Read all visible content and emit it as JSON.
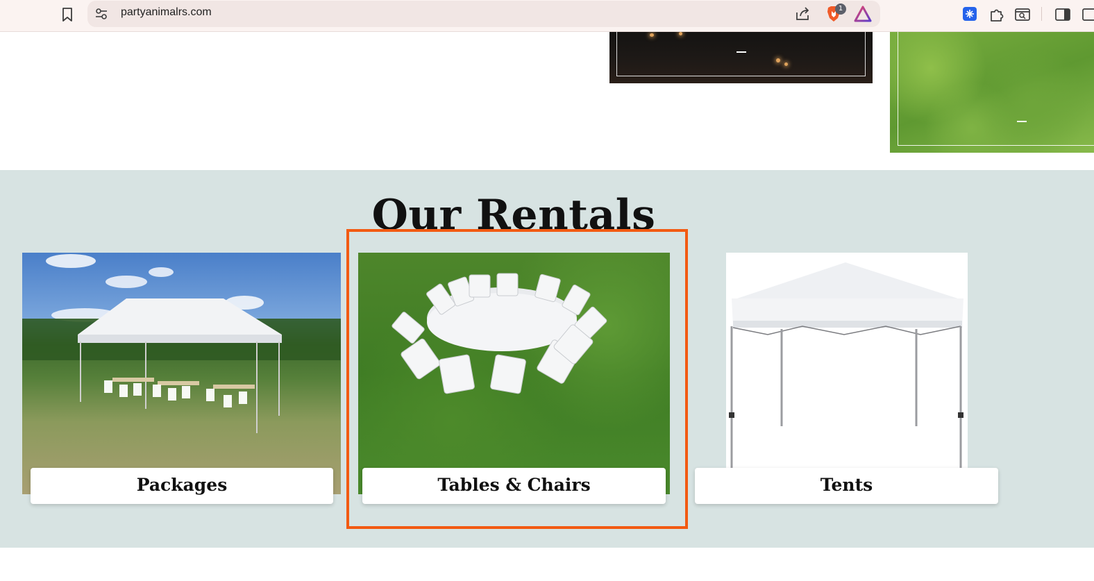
{
  "browser": {
    "url": "partyanimalrs.com",
    "brave_badge_count": "1",
    "icons": [
      "bookmark-icon",
      "site-info-icon",
      "share-icon",
      "brave-shield-icon",
      "brave-rewards-icon",
      "extension-icon",
      "puzzle-icon",
      "tab-search-icon",
      "sidepanel-icon",
      "window-icon"
    ],
    "colors": {
      "toolbar_bg": "#fbf3f1",
      "omnibox_bg": "#f1e6e4"
    }
  },
  "rentals": {
    "title": "Our Rentals",
    "background": "#d7e3e2",
    "cards": [
      {
        "label": "Packages",
        "image": "tent-with-tables-field-photo"
      },
      {
        "label": "Tables & Chairs",
        "image": "round-table-chairs-grass-photo"
      },
      {
        "label": "Tents",
        "image": "white-canopy-tent-photo"
      }
    ],
    "highlight_color": "#f25a12"
  }
}
